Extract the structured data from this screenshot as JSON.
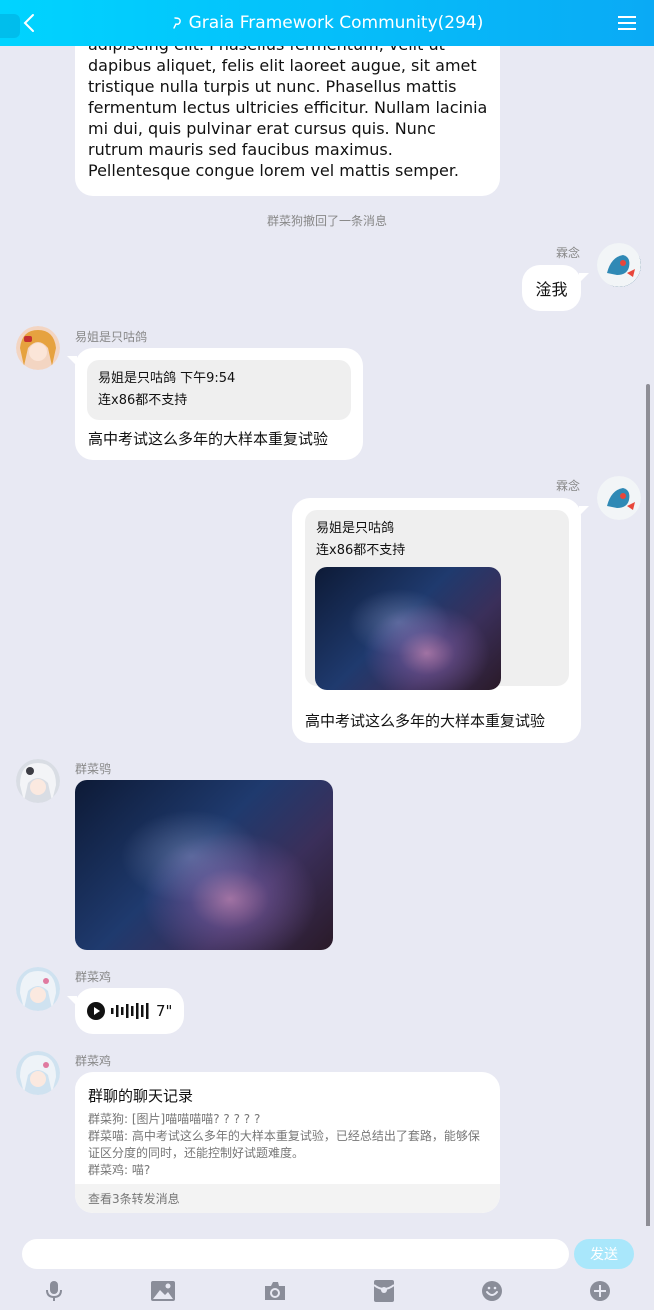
{
  "header": {
    "title": "Graia Framework Community(294)",
    "accent": "#0aaaf5"
  },
  "messages": {
    "m1": {
      "text": "adipiscing elit. Phasellus fermentum, velit ut dapibus aliquet, felis elit laoreet augue, sit amet tristique nulla turpis ut nunc. Phasellus mattis fermentum lectus ultricies efficitur. Nullam lacinia mi dui, quis pulvinar erat cursus quis. Nunc rutrum mauris sed faucibus maximus. Pellentesque congue lorem vel mattis semper."
    },
    "recall_notice": "群菜狗撤回了一条消息",
    "m2": {
      "sender": "霖念",
      "text": "淦我"
    },
    "m3": {
      "sender": "易姐是只咕鸽",
      "quote_author": "易姐是只咕鸽 下午9:54",
      "quote_text": "连x86都不支持",
      "text": "高中考试这么多年的大样本重复试验"
    },
    "m4": {
      "sender": "霖念",
      "quote_author": "易姐是只咕鸽",
      "quote_text": "连x86都不支持",
      "text": "高中考试这么多年的大样本重复试验"
    },
    "m5": {
      "sender": "群菜鸮"
    },
    "m6": {
      "sender": "群菜鸡",
      "duration": "7\""
    },
    "m7": {
      "sender": "群菜鸡",
      "title": "群聊的聊天记录",
      "lines": [
        "群菜狗: [图片]喵喵喵喵? ? ? ? ?",
        "群菜喵: 高中考试这么多年的大样本重复试验，已经总结出了套路，能够保证区分度的同时，还能控制好试题难度。",
        "群菜鸡: 喵?"
      ],
      "footer": "查看3条转发消息"
    }
  },
  "composer": {
    "placeholder": "",
    "send_label": "发送"
  }
}
